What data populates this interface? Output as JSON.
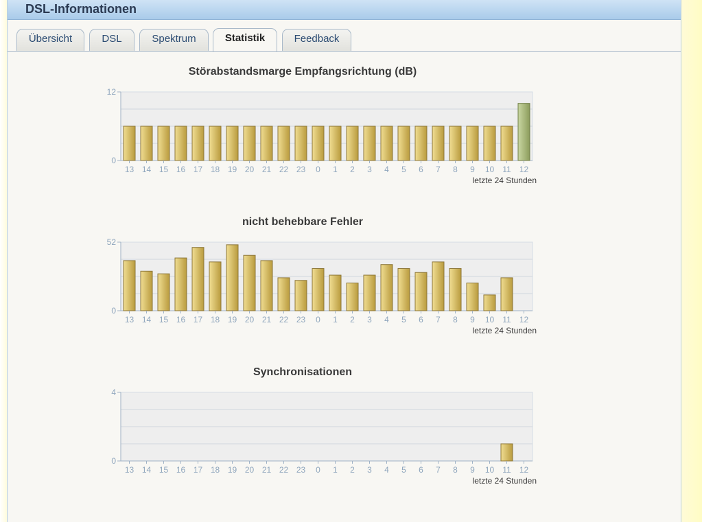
{
  "header": {
    "title": "DSL-Informationen"
  },
  "tabs": [
    {
      "label": "Übersicht",
      "active": false
    },
    {
      "label": "DSL",
      "active": false
    },
    {
      "label": "Spektrum",
      "active": false
    },
    {
      "label": "Statistik",
      "active": true
    },
    {
      "label": "Feedback",
      "active": false
    }
  ],
  "colors": {
    "bar": "#d6bd5e",
    "bar_highlight": "#a9b97a",
    "plot_bg": "#eeeeee",
    "axis": "#9fb2c6",
    "tick_label": "#8fa6bd"
  },
  "chart_data": [
    {
      "type": "bar",
      "title": "Störabstandsmarge Empfangsrichtung (dB)",
      "categories": [
        "13",
        "14",
        "15",
        "16",
        "17",
        "18",
        "19",
        "20",
        "21",
        "22",
        "23",
        "0",
        "1",
        "2",
        "3",
        "4",
        "5",
        "6",
        "7",
        "8",
        "9",
        "10",
        "11",
        "12"
      ],
      "values": [
        6,
        6,
        6,
        6,
        6,
        6,
        6,
        6,
        6,
        6,
        6,
        6,
        6,
        6,
        6,
        6,
        6,
        6,
        6,
        6,
        6,
        6,
        6,
        10
      ],
      "highlight_index": 23,
      "ylim": [
        0,
        12
      ],
      "ytick_labels": [
        "0",
        "12"
      ],
      "xlabel": "letzte 24 Stunden"
    },
    {
      "type": "bar",
      "title": "nicht behebbare Fehler",
      "categories": [
        "13",
        "14",
        "15",
        "16",
        "17",
        "18",
        "19",
        "20",
        "21",
        "22",
        "23",
        "0",
        "1",
        "2",
        "3",
        "4",
        "5",
        "6",
        "7",
        "8",
        "9",
        "10",
        "11",
        "12"
      ],
      "values": [
        38,
        30,
        28,
        40,
        48,
        37,
        50,
        42,
        38,
        25,
        23,
        32,
        27,
        21,
        27,
        35,
        32,
        29,
        37,
        32,
        21,
        12,
        25,
        0
      ],
      "ylim": [
        0,
        52
      ],
      "ytick_labels": [
        "0",
        "52"
      ],
      "xlabel": "letzte 24 Stunden"
    },
    {
      "type": "bar",
      "title": "Synchronisationen",
      "categories": [
        "13",
        "14",
        "15",
        "16",
        "17",
        "18",
        "19",
        "20",
        "21",
        "22",
        "23",
        "0",
        "1",
        "2",
        "3",
        "4",
        "5",
        "6",
        "7",
        "8",
        "9",
        "10",
        "11",
        "12"
      ],
      "values": [
        0,
        0,
        0,
        0,
        0,
        0,
        0,
        0,
        0,
        0,
        0,
        0,
        0,
        0,
        0,
        0,
        0,
        0,
        0,
        0,
        0,
        0,
        1,
        0
      ],
      "ylim": [
        0,
        4
      ],
      "ytick_labels": [
        "0",
        "4"
      ],
      "xlabel": "letzte 24 Stunden"
    }
  ]
}
